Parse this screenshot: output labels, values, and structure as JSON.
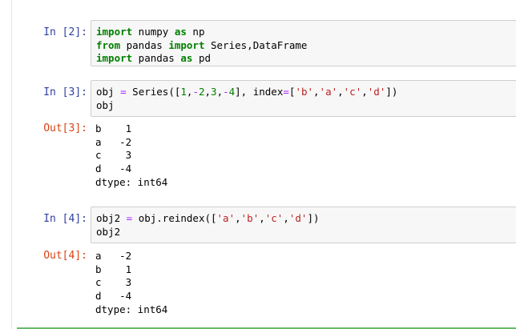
{
  "cells": [
    {
      "in_prompt": "In  [2]:",
      "lines": [
        [
          {
            "t": "import",
            "c": "kw"
          },
          {
            "t": " numpy ",
            "c": ""
          },
          {
            "t": "as",
            "c": "kw"
          },
          {
            "t": " np",
            "c": ""
          }
        ],
        [
          {
            "t": "from",
            "c": "kw"
          },
          {
            "t": " pandas ",
            "c": ""
          },
          {
            "t": "import",
            "c": "kw"
          },
          {
            "t": " Series,DataFrame",
            "c": ""
          }
        ],
        [
          {
            "t": "import",
            "c": "kw"
          },
          {
            "t": " pandas ",
            "c": ""
          },
          {
            "t": "as",
            "c": "kw"
          },
          {
            "t": " pd",
            "c": ""
          }
        ]
      ]
    },
    {
      "in_prompt": "In  [3]:",
      "lines": [
        [
          {
            "t": "obj ",
            "c": ""
          },
          {
            "t": "=",
            "c": "op"
          },
          {
            "t": " Series([",
            "c": ""
          },
          {
            "t": "1",
            "c": "num"
          },
          {
            "t": ",",
            "c": ""
          },
          {
            "t": "-",
            "c": "op"
          },
          {
            "t": "2",
            "c": "num"
          },
          {
            "t": ",",
            "c": ""
          },
          {
            "t": "3",
            "c": "num"
          },
          {
            "t": ",",
            "c": ""
          },
          {
            "t": "-",
            "c": "op"
          },
          {
            "t": "4",
            "c": "num"
          },
          {
            "t": "], index",
            "c": ""
          },
          {
            "t": "=",
            "c": "op"
          },
          {
            "t": "[",
            "c": ""
          },
          {
            "t": "'b'",
            "c": "str"
          },
          {
            "t": ",",
            "c": ""
          },
          {
            "t": "'a'",
            "c": "str"
          },
          {
            "t": ",",
            "c": ""
          },
          {
            "t": "'c'",
            "c": "str"
          },
          {
            "t": ",",
            "c": ""
          },
          {
            "t": "'d'",
            "c": "str"
          },
          {
            "t": "])",
            "c": ""
          }
        ],
        [
          {
            "t": "obj",
            "c": ""
          }
        ]
      ],
      "out_prompt": "Out[3]:",
      "output": [
        "b    1",
        "a   -2",
        "c    3",
        "d   -4",
        "dtype: int64"
      ]
    },
    {
      "in_prompt": "In  [4]:",
      "lines": [
        [
          {
            "t": "obj2 ",
            "c": ""
          },
          {
            "t": "=",
            "c": "op"
          },
          {
            "t": " obj.reindex([",
            "c": ""
          },
          {
            "t": "'a'",
            "c": "str"
          },
          {
            "t": ",",
            "c": ""
          },
          {
            "t": "'b'",
            "c": "str"
          },
          {
            "t": ",",
            "c": ""
          },
          {
            "t": "'c'",
            "c": "str"
          },
          {
            "t": ",",
            "c": ""
          },
          {
            "t": "'d'",
            "c": "str"
          },
          {
            "t": "])",
            "c": ""
          }
        ],
        [
          {
            "t": "obj2",
            "c": ""
          }
        ]
      ],
      "out_prompt": "Out[4]:",
      "output": [
        "a   -2",
        "b    1",
        "c    3",
        "d   -4",
        "dtype: int64"
      ]
    }
  ],
  "colors": {
    "in_prompt": "#303f9f",
    "out_prompt": "#d84315",
    "keyword": "#008000",
    "string": "#ba2121",
    "operator": "#aa22ff",
    "selected_bar": "#66bb6a"
  }
}
